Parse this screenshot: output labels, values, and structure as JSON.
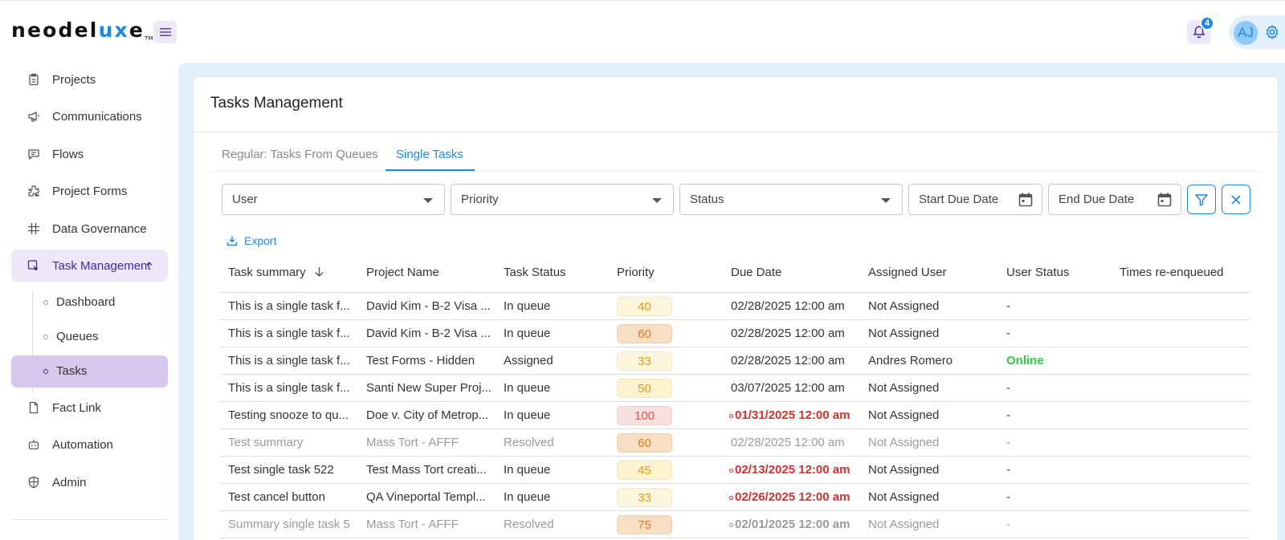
{
  "brand": {
    "logo_prefix": "neodel",
    "logo_accent": "ux",
    "logo_suffix": "e",
    "logo_tm": "TM"
  },
  "header": {
    "notification_count": "4",
    "avatar_initials": "AJ"
  },
  "sidebar": {
    "items": [
      {
        "label": "Projects",
        "icon": "clipboard-icon"
      },
      {
        "label": "Communications",
        "icon": "megaphone-icon"
      },
      {
        "label": "Flows",
        "icon": "chat-icon"
      },
      {
        "label": "Project Forms",
        "icon": "puzzle-icon"
      },
      {
        "label": "Data Governance",
        "icon": "grid-icon"
      },
      {
        "label": "Task Management",
        "icon": "task-icon"
      },
      {
        "label": "Fact Link",
        "icon": "file-icon"
      },
      {
        "label": "Automation",
        "icon": "robot-icon"
      },
      {
        "label": "Admin",
        "icon": "shield-icon"
      }
    ],
    "sub_items": [
      {
        "label": "Dashboard"
      },
      {
        "label": "Queues"
      },
      {
        "label": "Tasks"
      }
    ]
  },
  "page": {
    "title": "Tasks Management",
    "tabs": [
      {
        "label": "Regular: Tasks From Queues"
      },
      {
        "label": "Single Tasks"
      }
    ],
    "filters": {
      "user": "User",
      "priority": "Priority",
      "status": "Status",
      "start_due_date": "Start Due Date",
      "end_due_date": "End Due Date"
    },
    "export_label": "Export"
  },
  "table": {
    "columns": [
      "Task summary",
      "Project Name",
      "Task Status",
      "Priority",
      "Due Date",
      "Assigned User",
      "User Status",
      "Times re-enqueued"
    ],
    "rows": [
      {
        "summary": "This is a single task f...",
        "project": "David Kim - B-2 Visa ...",
        "status": "In queue",
        "priority": "40",
        "priority_bg": "#fdf6dc",
        "priority_color": "#e69a12",
        "due": "02/28/2025 12:00 am",
        "overdue": false,
        "assigned": "Not Assigned",
        "user_status": "-",
        "dim": false
      },
      {
        "summary": "This is a single task f...",
        "project": "David Kim - B-2 Visa ...",
        "status": "In queue",
        "priority": "60",
        "priority_bg": "#f8dfc4",
        "priority_color": "#e07a12",
        "due": "02/28/2025 12:00 am",
        "overdue": false,
        "assigned": "Not Assigned",
        "user_status": "-",
        "dim": false
      },
      {
        "summary": "This is a single task f...",
        "project": "Test Forms - Hidden",
        "status": "Assigned",
        "priority": "33",
        "priority_bg": "#fdf6dc",
        "priority_color": "#e69a12",
        "due": "02/28/2025 12:00 am",
        "overdue": false,
        "assigned": "Andres Romero",
        "user_status": "Online",
        "dim": false
      },
      {
        "summary": "This is a single task f...",
        "project": "Santi New Super Proj...",
        "status": "In queue",
        "priority": "50",
        "priority_bg": "#fdf3cf",
        "priority_color": "#e69a12",
        "due": "03/07/2025 12:00 am",
        "overdue": false,
        "assigned": "Not Assigned",
        "user_status": "-",
        "dim": false
      },
      {
        "summary": "Testing snooze to qu...",
        "project": "Doe v. City of Metrop...",
        "status": "In queue",
        "priority": "100",
        "priority_bg": "#f8e0e0",
        "priority_color": "#d9534f",
        "due": "01/31/2025 12:00 am",
        "overdue": true,
        "assigned": "Not Assigned",
        "user_status": "-",
        "dim": false
      },
      {
        "summary": "Test summary",
        "project": "Mass Tort - AFFF",
        "status": "Resolved",
        "priority": "60",
        "priority_bg": "#f8dfc4",
        "priority_color": "#e07a12",
        "due": "02/28/2025 12:00 am",
        "overdue": false,
        "assigned": "Not Assigned",
        "user_status": "-",
        "dim": true
      },
      {
        "summary": "Test single task 522",
        "project": "Test Mass Tort creati...",
        "status": "In queue",
        "priority": "45",
        "priority_bg": "#fdf3cf",
        "priority_color": "#e69a12",
        "due": "02/13/2025 12:00 am",
        "overdue": true,
        "assigned": "Not Assigned",
        "user_status": "-",
        "dim": false
      },
      {
        "summary": "Test cancel button",
        "project": "QA Vineportal Templ...",
        "status": "In queue",
        "priority": "33",
        "priority_bg": "#fdf6dc",
        "priority_color": "#e69a12",
        "due": "02/26/2025 12:00 am",
        "overdue": true,
        "assigned": "Not Assigned",
        "user_status": "-",
        "dim": false
      },
      {
        "summary": "Summary single task 5",
        "project": "Mass Tort - AFFF",
        "status": "Resolved",
        "priority": "75",
        "priority_bg": "#f8dfc4",
        "priority_color": "#e07a12",
        "due": "02/01/2025 12:00 am",
        "overdue": true,
        "assigned": "Not Assigned",
        "user_status": "-",
        "dim": true
      }
    ]
  }
}
